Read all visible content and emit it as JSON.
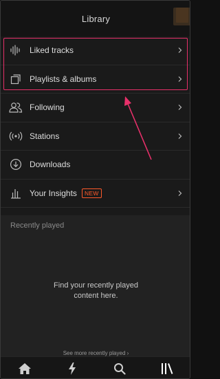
{
  "header": {
    "title": "Library"
  },
  "menu": {
    "items": [
      {
        "label": "Liked tracks",
        "icon": "waveform-icon"
      },
      {
        "label": "Playlists & albums",
        "icon": "stacked-squares-icon"
      },
      {
        "label": "Following",
        "icon": "people-icon"
      },
      {
        "label": "Stations",
        "icon": "broadcast-icon"
      },
      {
        "label": "Downloads",
        "icon": "download-icon"
      },
      {
        "label": "Your Insights",
        "icon": "bar-chart-icon",
        "badge": "NEW"
      }
    ]
  },
  "recent": {
    "title": "Recently played",
    "empty_message": "Find your recently played\ncontent here.",
    "see_more": "See more recently played ›"
  },
  "tabbar": {
    "tabs": [
      {
        "name": "home",
        "icon": "home-icon"
      },
      {
        "name": "stream",
        "icon": "lightning-icon"
      },
      {
        "name": "search",
        "icon": "search-icon"
      },
      {
        "name": "library",
        "icon": "library-icon",
        "active": true
      }
    ]
  },
  "colors": {
    "accent": "#ff5a2a",
    "annotation": "#e8306a",
    "background": "#1a1a1a"
  }
}
